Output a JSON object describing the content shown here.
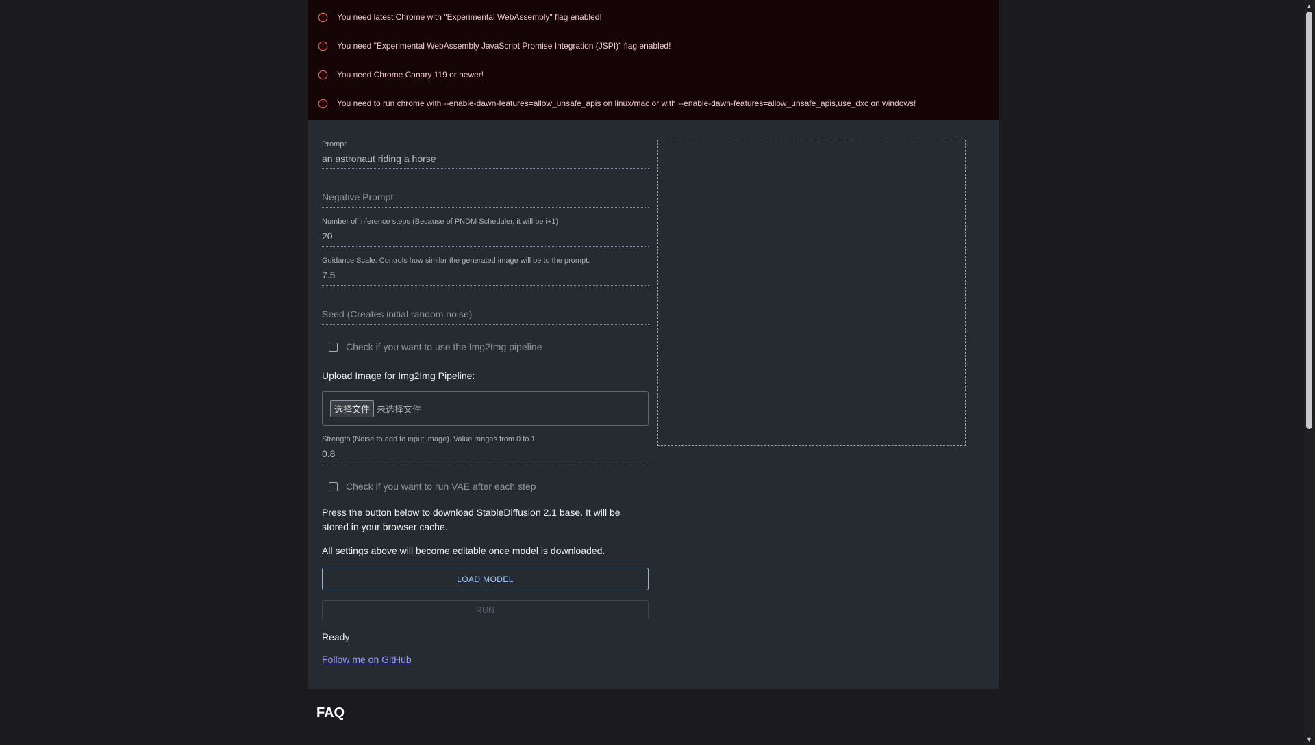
{
  "alerts": [
    "You need latest Chrome with \"Experimental WebAssembly\" flag enabled!",
    "You need \"Experimental WebAssembly JavaScript Promise Integration (JSPI)\" flag enabled!",
    "You need Chrome Canary 119 or newer!",
    "You need to run chrome with --enable-dawn-features=allow_unsafe_apis on linux/mac or with --enable-dawn-features=allow_unsafe_apis,use_dxc on windows!"
  ],
  "form": {
    "prompt_label": "Prompt",
    "prompt_value": "an astronaut riding a horse",
    "negative_prompt_placeholder": "Negative Prompt",
    "steps_label": "Number of inference steps (Because of PNDM Scheduler, it will be i+1)",
    "steps_value": "20",
    "guidance_label": "Guidance Scale. Controls how similar the generated image will be to the prompt.",
    "guidance_value": "7.5",
    "seed_placeholder": "Seed (Creates initial random noise)",
    "img2img_checkbox_label": "Check if you want to use the Img2Img pipeline",
    "upload_label": "Upload Image for Img2Img Pipeline:",
    "file_button": "选择文件",
    "file_status": "未选择文件",
    "strength_label": "Strength (Noise to add to input image). Value ranges from 0 to 1",
    "strength_value": "0.8",
    "vae_checkbox_label": "Check if you want to run VAE after each step",
    "download_info": "Press the button below to download StableDiffusion 2.1 base. It will be stored in your browser cache.",
    "editable_info": "All settings above will become editable once model is downloaded.",
    "load_button": "LOAD MODEL",
    "run_button": "RUN",
    "status": "Ready",
    "github_link": "Follow me on GitHub"
  },
  "faq_heading": "FAQ",
  "colors": {
    "alert_bg": "#150506",
    "panel_bg": "#262a31",
    "page_bg": "#1b1b1d",
    "alert_icon": "#e05757",
    "link": "#9a9cf8",
    "load_button_text": "#9ec8ff"
  },
  "icons": {
    "alert": "error-outline-icon"
  }
}
